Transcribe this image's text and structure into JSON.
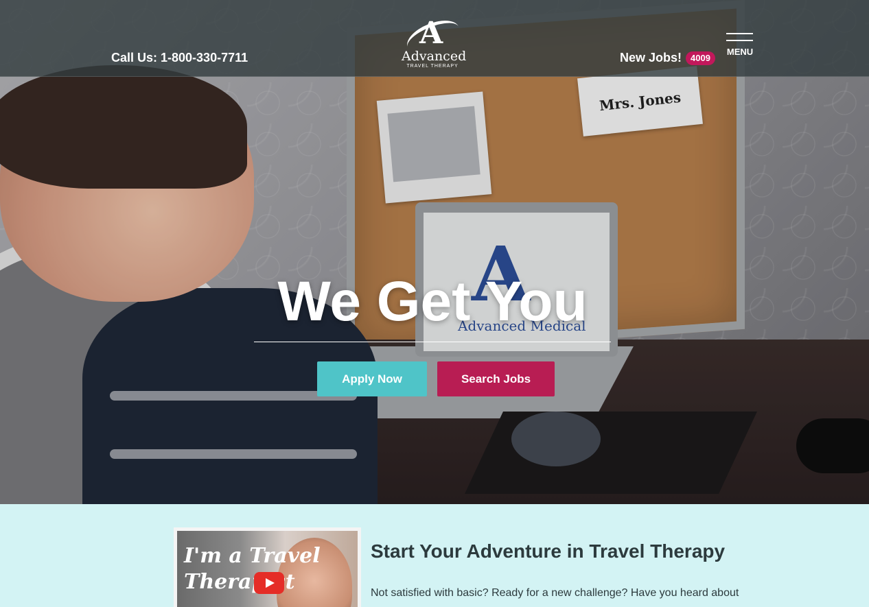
{
  "header": {
    "phone_text": "Call Us: 1-800-330-7711",
    "logo_name": "Advanced",
    "logo_sub": "TRAVEL THERAPY",
    "new_jobs_label": "New Jobs!",
    "new_jobs_count": "4009",
    "menu_label": "MENU"
  },
  "hero": {
    "title": "We Get You",
    "name_card": "Mrs. Jones",
    "laptop_text": "Advanced Medical",
    "apply_label": "Apply Now",
    "search_label": "Search Jobs"
  },
  "section": {
    "video_thumb_text": "I'm a Travel Therapist",
    "title": "Start Your Adventure in Travel Therapy",
    "text": "Not satisfied with basic? Ready for a new challenge? Have you heard about"
  },
  "colors": {
    "accent_teal": "#4fc4c8",
    "accent_magenta": "#b81d53",
    "badge": "#c2185b",
    "section_bg": "#d3f3f4"
  }
}
